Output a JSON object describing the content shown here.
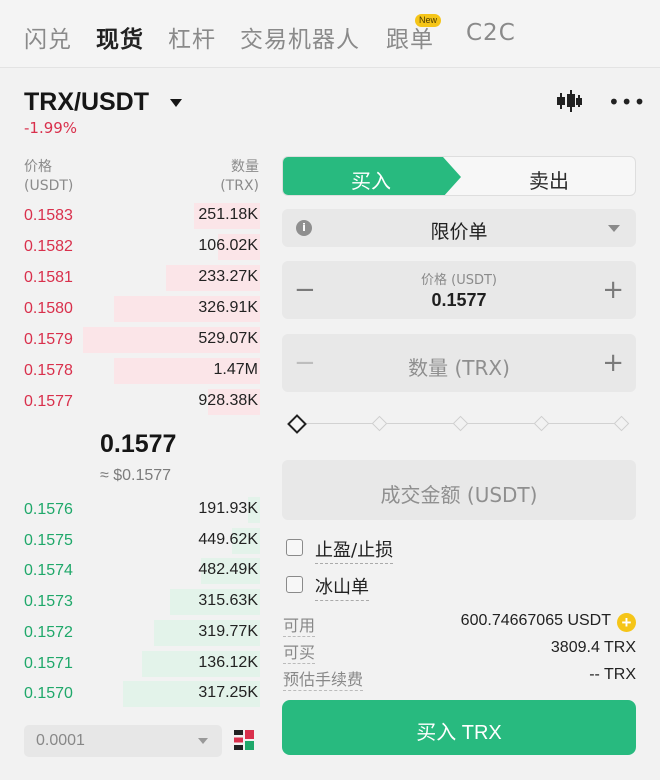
{
  "nav": {
    "tabs": [
      {
        "label": "闪兑",
        "active": false
      },
      {
        "label": "现货",
        "active": true
      },
      {
        "label": "杠杆",
        "active": false
      },
      {
        "label": "交易机器人",
        "active": false
      },
      {
        "label": "跟单",
        "active": false
      },
      {
        "label": "C2C",
        "active": false
      }
    ],
    "new_badge": "New"
  },
  "header": {
    "pair": "TRX/USDT",
    "change": "-1.99%",
    "icons": [
      "candlestick-chart-icon",
      "more-icon"
    ]
  },
  "orderbook": {
    "price_header": "价格",
    "price_unit": "(USDT)",
    "qty_header": "数量",
    "qty_unit": "(TRX)",
    "asks": [
      {
        "price": "0.1583",
        "qty": "251.18K",
        "depth": 0.28
      },
      {
        "price": "0.1582",
        "qty": "106.02K",
        "depth": 0.18
      },
      {
        "price": "0.1581",
        "qty": "233.27K",
        "depth": 0.4
      },
      {
        "price": "0.1580",
        "qty": "326.91K",
        "depth": 0.62
      },
      {
        "price": "0.1579",
        "qty": "529.07K",
        "depth": 0.75
      },
      {
        "price": "0.1578",
        "qty": "1.47M",
        "depth": 0.62
      },
      {
        "price": "0.1577",
        "qty": "928.38K",
        "depth": 0.22
      }
    ],
    "last_price": "0.1577",
    "last_price_usd": "≈ $0.1577",
    "bids": [
      {
        "price": "0.1576",
        "qty": "191.93K",
        "depth": 0.05
      },
      {
        "price": "0.1575",
        "qty": "449.62K",
        "depth": 0.12
      },
      {
        "price": "0.1574",
        "qty": "482.49K",
        "depth": 0.25
      },
      {
        "price": "0.1573",
        "qty": "315.63K",
        "depth": 0.38
      },
      {
        "price": "0.1572",
        "qty": "319.77K",
        "depth": 0.45
      },
      {
        "price": "0.1571",
        "qty": "136.12K",
        "depth": 0.5
      },
      {
        "price": "0.1570",
        "qty": "317.25K",
        "depth": 0.58
      }
    ],
    "precision": "0.0001"
  },
  "order_form": {
    "buy_label": "买入",
    "sell_label": "卖出",
    "order_type": "限价单",
    "price_label": "价格 (USDT)",
    "price_value": "0.1577",
    "qty_placeholder": "数量 (TRX)",
    "amount_placeholder": "成交金额 (USDT)",
    "slider_value": 0,
    "tp_sl_label": "止盈/止损",
    "iceberg_label": "冰山单",
    "available_label": "可用",
    "available_value": "600.74667065 USDT",
    "can_buy_label": "可买",
    "can_buy_value": "3809.4 TRX",
    "fee_label": "预估手续费",
    "fee_value": "-- TRX",
    "submit_label": "买入 TRX",
    "colors": {
      "buy": "#28ba7f",
      "ask": "#d9304c",
      "bid": "#1fa86a",
      "badge": "#f5c518"
    }
  }
}
